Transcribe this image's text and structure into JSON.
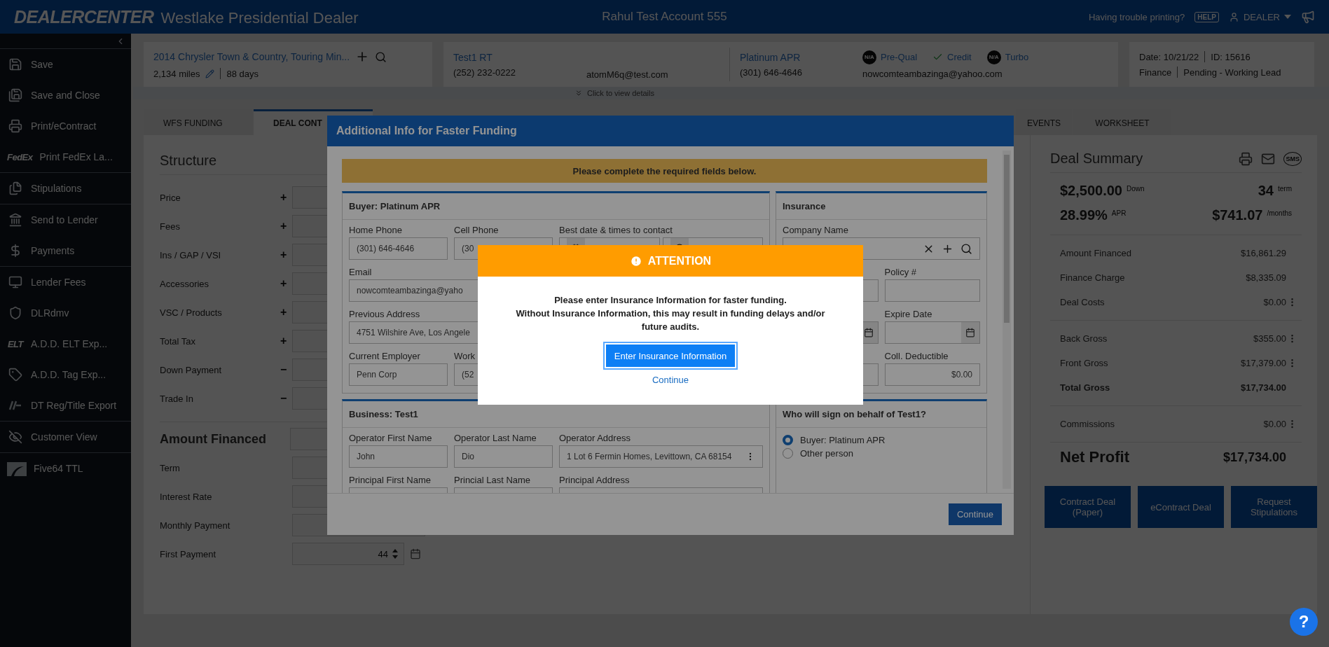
{
  "header": {
    "logo": "DEALERCENTER",
    "dealer": "Westlake Presidential Dealer",
    "account": "Rahul Test Account 555",
    "print_help": "Having trouble printing?",
    "help_badge": "HELP",
    "user": "DEALER"
  },
  "sidebar": {
    "groups": [
      [
        {
          "label": "Save"
        },
        {
          "label": "Save and Close"
        },
        {
          "label": "Print/eContract"
        },
        {
          "badge": "FedEx",
          "label": "Print FedEx La..."
        }
      ],
      [
        {
          "label": "Stipulations"
        }
      ],
      [
        {
          "label": "Send to Lender"
        },
        {
          "label": "Payments"
        }
      ],
      [
        {
          "label": "Lender Fees"
        },
        {
          "label": "DLRdmv"
        },
        {
          "badge": "ELT",
          "label": "A.D.D. ELT Exp..."
        },
        {
          "label": "A.D.D. Tag Exp..."
        },
        {
          "label": "DT Reg/Title Export"
        }
      ],
      [
        {
          "label": "Customer View"
        }
      ],
      [
        {
          "label": "Five64 TTL"
        }
      ]
    ]
  },
  "deal_header": {
    "vehicle": {
      "title": "2014 Chrysler Town & Country, Touring Min...",
      "miles": "2,134 miles",
      "days": "88 days"
    },
    "buyer": {
      "name": "Test1 RT",
      "phone": "(252) 232-0222",
      "email": "atomM6q@test.com"
    },
    "cobuyer": {
      "name": "Platinum APR",
      "phone": "(301) 646-4646",
      "email": "nowcomteambazinga@yahoo.com"
    },
    "checks": [
      {
        "kind": "na",
        "badge": "N/A",
        "label": "Pre-Qual"
      },
      {
        "kind": "done",
        "label": "Credit"
      },
      {
        "kind": "na",
        "badge": "N/A",
        "label": "Turbo"
      }
    ],
    "meta": {
      "date": "Date: 10/21/22",
      "id": "ID: 15616",
      "department": "Finance",
      "status": "Pending - Working Lead"
    }
  },
  "details_toggle": "Click to view details",
  "tabs": [
    {
      "label": "WFS FUNDING",
      "selected": false
    },
    {
      "label": "DEAL CONT",
      "selected": true
    },
    {
      "label": "EVENTS",
      "selected": false
    },
    {
      "label": "WORKSHEET",
      "selected": false
    }
  ],
  "structure": {
    "title": "Structure",
    "rows": [
      {
        "label": "Price",
        "sign": "+"
      },
      {
        "label": "Fees",
        "sign": "+"
      },
      {
        "label": "Ins / GAP / VSI",
        "sign": "+"
      },
      {
        "label": "Accessories",
        "sign": "+"
      },
      {
        "label": "VSC / Products",
        "sign": "+"
      },
      {
        "label": "Total Tax",
        "sign": "+"
      },
      {
        "label": "Down Payment",
        "sign": "−"
      },
      {
        "label": "Trade In",
        "sign": "−"
      }
    ],
    "total_label": "Amount Financed",
    "terms": [
      {
        "kind": "plain",
        "label": "Term"
      },
      {
        "kind": "plain",
        "label": "Interest Rate"
      },
      {
        "kind": "menu",
        "label": "Monthly Payment"
      },
      {
        "kind": "date",
        "label": "First Payment",
        "value": "44"
      }
    ]
  },
  "deal_summary": {
    "title": "Deal Summary",
    "sms_badge": "SMS",
    "stats": [
      {
        "value": "$2,500.00",
        "unit": "Down"
      },
      {
        "value": "34",
        "unit": "term"
      },
      {
        "value": "28.99%",
        "unit": "APR"
      },
      {
        "value": "$741.07",
        "unit": "/months"
      }
    ],
    "groups": [
      [
        {
          "kind": "line",
          "label": "Amount Financed",
          "value": "$16,861.29",
          "menu": false
        },
        {
          "kind": "line",
          "label": "Finance Charge",
          "value": "$8,335.09",
          "menu": false
        },
        {
          "kind": "line",
          "label": "Deal Costs",
          "value": "$0.00",
          "menu": true
        }
      ],
      [
        {
          "kind": "line",
          "label": "Back Gross",
          "value": "$355.00",
          "menu": true
        },
        {
          "kind": "line",
          "label": "Front Gross",
          "value": "$17,379.00",
          "menu": true
        },
        {
          "kind": "total",
          "label": "Total Gross",
          "value": "$17,734.00",
          "menu": false
        }
      ],
      [
        {
          "kind": "line",
          "label": "Commissions",
          "value": "$0.00",
          "menu": true
        }
      ]
    ],
    "net_label": "Net Profit",
    "net_value": "$17,734.00",
    "actions": [
      "Contract Deal (Paper)",
      "eContract Deal",
      "Request Stipulations"
    ]
  },
  "funding_modal": {
    "title": "Additional Info for Faster Funding",
    "banner": "Please complete the required fields below.",
    "buyer": {
      "title": "Buyer: Platinum APR",
      "home_phone": {
        "label": "Home Phone",
        "value": "(301) 646-4646"
      },
      "cell_phone": {
        "label": "Cell Phone",
        "value": "(30"
      },
      "contact_label": "Best date & times to contact",
      "email": {
        "label": "Email",
        "value": "nowcomteambazinga@yaho"
      },
      "previous_address": {
        "label": "Previous Address",
        "value": "4751 Wilshire Ave, Los Angele"
      },
      "employer": {
        "label": "Current Employer",
        "value": "Penn Corp"
      },
      "work_phone": {
        "label": "Work",
        "value": "(52"
      }
    },
    "insurance": {
      "title": "Insurance",
      "company_label": "Company Name",
      "policy_label": "Policy #",
      "expire_label": "Expire Date",
      "deductible": {
        "label": "Coll. Deductible",
        "value": "$0.00"
      }
    },
    "business": {
      "title": "Business: Test1",
      "operator_first": {
        "label": "Operator First Name",
        "value": "John"
      },
      "operator_last": {
        "label": "Operator Last Name",
        "value": "Dio"
      },
      "operator_address": {
        "label": "Operator Address",
        "value": "1 Lot 6 Fermin Homes, Levittown, CA 68154"
      },
      "principal_first_label": "Principal First Name",
      "principal_last_label": "Princial Last Name",
      "principal_address_label": "Principal Address"
    },
    "signer": {
      "title": "Who will sign on behalf of Test1?",
      "options": [
        {
          "label": "Buyer: Platinum APR",
          "selected": true
        },
        {
          "label": "Other person",
          "selected": false
        }
      ]
    },
    "continue": "Continue"
  },
  "attention": {
    "title": "ATTENTION",
    "lines": [
      "Please enter Insurance Information for faster funding.",
      "Without Insurance Information, this may result in funding delays and/or future audits."
    ],
    "primary": "Enter Insurance Information",
    "secondary": "Continue"
  },
  "help_fab": "?"
}
